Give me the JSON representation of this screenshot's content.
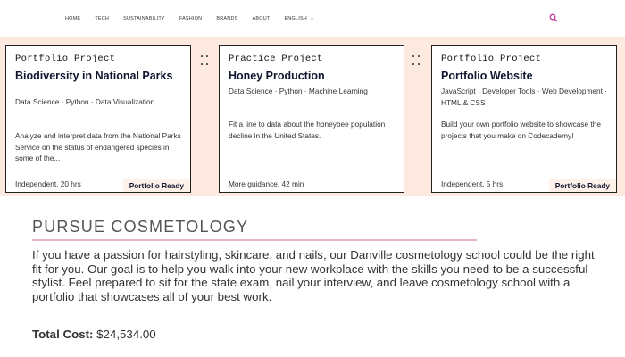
{
  "nav": {
    "items": [
      "HOME",
      "TECH",
      "SUSTAINABILITY",
      "FASHION",
      "BRANDS",
      "ABOUT"
    ],
    "language": "ENGLISH",
    "search_icon": "search-icon",
    "accent": "#c0399b"
  },
  "cards": [
    {
      "kicker": "Portfolio Project",
      "title": "Biodiversity in National Parks",
      "tags": "Data Science · Python · Data Visualization",
      "description": "Analyze and interpret data from the National Parks Service on the status of endangered species in some of the...",
      "footer": "Independent, 20 hrs",
      "badge": "Portfolio Ready"
    },
    {
      "kicker": "Practice Project",
      "title": "Honey Production",
      "tags": "Data Science · Python · Machine Learning",
      "description": "Fit a line to data about the honeybee population decline in the United States.",
      "footer": "More guidance, 42 min",
      "badge": ""
    },
    {
      "kicker": "Portfolio Project",
      "title": "Portfolio Website",
      "tags": "JavaScript · Developer Tools · Web Development · HTML & CSS",
      "description": "Build your own portfolio website to showcase the projects that you make on Codecademy!",
      "footer": "Independent, 5 hrs",
      "badge": "Portfolio Ready"
    }
  ],
  "cosmetology": {
    "title": "PURSUE COSMETOLOGY",
    "body": "If you have a passion for hairstyling, skincare, and nails, our Danville cosmetology school could be the right fit for you. Our goal is to help you walk into your new workplace with the skills you need to be a successful stylist. Feel prepared to sit for the state exam, nail your interview, and leave cosmetology school with a portfolio that showcases all of your best work.",
    "cost_label": "Total Cost:",
    "cost_value": "$24,534.00"
  }
}
